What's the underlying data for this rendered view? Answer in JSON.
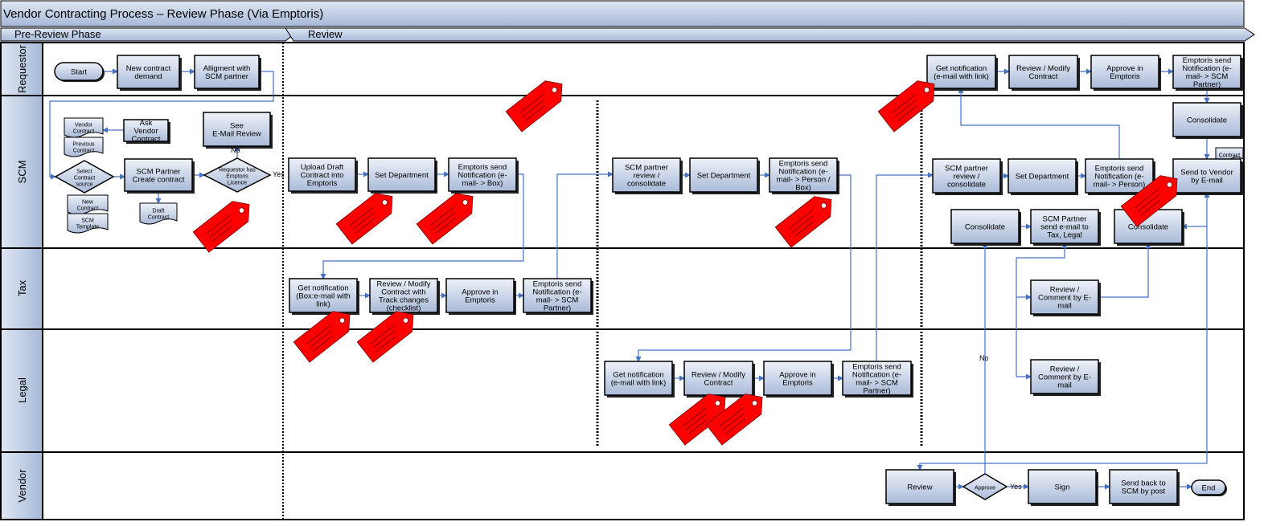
{
  "title": "Vendor Contracting Process – Review Phase (Via Emptoris)",
  "phases": [
    "Pre-Review Phase",
    "Review"
  ],
  "lanes": [
    "Requestor",
    "SCM",
    "Tax",
    "Legal",
    "Vendor"
  ],
  "nodes": {
    "start": "Start",
    "new_contract_demand": [
      "New contract",
      "demand"
    ],
    "alignment": [
      "Alligment with",
      "SCM partner"
    ],
    "ask_vendor": [
      "Ask",
      "Vendor",
      "Contract"
    ],
    "vendor_contract_doc": [
      "Vendor",
      "Contract"
    ],
    "previous_contract_doc": [
      "Previous",
      "Contract"
    ],
    "select_source": [
      "Select",
      "Contract",
      "source"
    ],
    "new_contract_doc": [
      "New",
      "Contract"
    ],
    "scm_template_doc": [
      "SCM",
      "Template"
    ],
    "scm_partner_create": [
      "SCM Partner",
      "Create contract"
    ],
    "draft_contract_doc": [
      "Draft",
      "Contract"
    ],
    "see_email_review": [
      "See",
      "E-Mail Review"
    ],
    "requestor_has_licence": [
      "Requestor has",
      "Emptoris",
      "Licence"
    ],
    "upload_draft": [
      "Upload Draft",
      "Contract into",
      "Emptoris"
    ],
    "set_dept_1": [
      "Set Department"
    ],
    "emptoris_notify_box": [
      "Emptoris send",
      "Notification (e-",
      "mail- > Box)"
    ],
    "tax_get_notification": [
      "Get notification",
      "(Box:e-mail with",
      "link)"
    ],
    "tax_review_modify": [
      "Review / Modify",
      "Contract with",
      "Track changes",
      "(checklist)"
    ],
    "tax_approve": [
      "Approve in",
      "Emptoris"
    ],
    "tax_emptoris_notify": [
      "Emptoris send",
      "Notification (e-",
      "mail- > SCM",
      "Partner)"
    ],
    "scm_review_consolidate_1": [
      "SCM partner",
      "review /",
      "consolidate"
    ],
    "set_dept_2": [
      "Set Department"
    ],
    "emptoris_notify_person_box": [
      "Emptoris send",
      "Notification (e-",
      "mail- > Person /",
      "Box)"
    ],
    "legal_get_notification": [
      "Get notification",
      "(e-mail with link)"
    ],
    "legal_review_modify": [
      "Review / Modify",
      "Contract"
    ],
    "legal_approve": [
      "Approve in",
      "Emptoris"
    ],
    "legal_emptoris_notify": [
      "Emptoris send",
      "Notification (e-",
      "mail- > SCM",
      "Partner)"
    ],
    "req_get_notification": [
      "Get notification",
      "(e-mail with link)"
    ],
    "req_review_modify": [
      "Review / Modify",
      "Contract"
    ],
    "req_approve": [
      "Approve in",
      "Emptoris"
    ],
    "req_emptoris_notify": [
      "Emptoris send",
      "Notification (e-",
      "mail- > SCM",
      "Partner)"
    ],
    "scm_review_consolidate_2": [
      "SCM partner",
      "review /",
      "consolidate"
    ],
    "set_dept_3": [
      "Set Department"
    ],
    "emptoris_notify_person": [
      "Emptoris send",
      "Notification (e-",
      "mail- > Person)"
    ],
    "consolidate_top": [
      "Consolidate"
    ],
    "contract_doc": [
      "Contract"
    ],
    "send_to_vendor": [
      "Send to Vendor",
      "by E-mail"
    ],
    "consolidate_left": [
      "Consolidate"
    ],
    "scm_send_tax_legal": [
      "SCM Partner",
      "send e-mail to",
      "Tax, Legal"
    ],
    "consolidate_right": [
      "Consolidate"
    ],
    "tax_review_comment": [
      "Review /",
      "Comment by E-",
      "mail"
    ],
    "legal_review_comment": [
      "Review /",
      "Comment by E-",
      "mail"
    ],
    "vendor_review": [
      "Review"
    ],
    "vendor_approve": [
      "Approve"
    ],
    "vendor_sign": [
      "Sign"
    ],
    "send_back_post": [
      "Send back to",
      "SCM by post"
    ],
    "end": "End"
  },
  "connector_labels": {
    "no_licence": "No",
    "yes_licence": "Yes",
    "no_approve": "No",
    "yes_approve": "Yes"
  },
  "colors": {
    "box_fill_top": "#eef2f9",
    "box_fill_bottom": "#a9bad8",
    "lane_header": "#b9c8e2",
    "connector": "#4472c4",
    "tag": "#ff0000",
    "border": "#000000"
  }
}
